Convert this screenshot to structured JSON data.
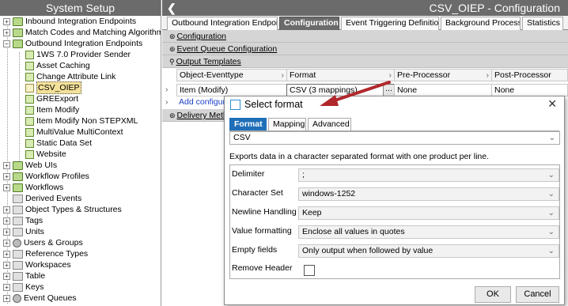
{
  "left_panel": {
    "title": "System Setup",
    "items": [
      {
        "label": "Inbound Integration Endpoints",
        "icon": "folder-icon"
      },
      {
        "label": "Match Codes and Matching Algorithms",
        "icon": "folder-icon"
      },
      {
        "label": "Outbound Integration Endpoints",
        "icon": "folder-icon"
      },
      {
        "label": "1WS 7.0 Provider Sender",
        "icon": "endpoint-icon"
      },
      {
        "label": "Asset Caching",
        "icon": "endpoint-icon"
      },
      {
        "label": "Change Attribute Link",
        "icon": "endpoint-icon"
      },
      {
        "label": "CSV_OIEP",
        "icon": "endpoint-icon"
      },
      {
        "label": "GREExport",
        "icon": "endpoint-icon"
      },
      {
        "label": "Item Modify",
        "icon": "endpoint-icon"
      },
      {
        "label": "Item Modify Non STEPXML",
        "icon": "endpoint-icon"
      },
      {
        "label": "MultiValue MultiContext",
        "icon": "endpoint-icon"
      },
      {
        "label": "Static Data Set",
        "icon": "endpoint-icon"
      },
      {
        "label": "Website",
        "icon": "endpoint-icon"
      },
      {
        "label": "Web UIs",
        "icon": "folder-icon"
      },
      {
        "label": "Workflow Profiles",
        "icon": "folder-icon"
      },
      {
        "label": "Workflows",
        "icon": "folder-icon"
      },
      {
        "label": "Derived Events",
        "icon": "list-icon"
      },
      {
        "label": "Object Types & Structures",
        "icon": "structure-icon"
      },
      {
        "label": "Tags",
        "icon": "tag-icon"
      },
      {
        "label": "Units",
        "icon": "units-icon"
      },
      {
        "label": "Users & Groups",
        "icon": "users-icon"
      },
      {
        "label": "Reference Types",
        "icon": "reference-icon"
      },
      {
        "label": "Workspaces",
        "icon": "workspace-icon"
      },
      {
        "label": "Table",
        "icon": "table-icon"
      },
      {
        "label": "Keys",
        "icon": "key-icon"
      },
      {
        "label": "Event Queues",
        "icon": "queue-icon"
      }
    ]
  },
  "right_panel": {
    "title": "CSV_OIEP - Configuration",
    "tabs": [
      "Outbound Integration Endpoint",
      "Configuration",
      "Event Triggering Definitions",
      "Background Processes",
      "Statistics"
    ],
    "sections": {
      "configuration": "Configuration",
      "event_queue": "Event Queue Configuration",
      "output_templates": "Output Templates",
      "delivery_method": "Delivery Method"
    },
    "grid": {
      "headers": [
        "Object-Eventtype",
        "Format",
        "Pre-Processor",
        "Post-Processor"
      ],
      "row": [
        "Item (Modify)",
        "CSV (3 mappings)",
        "None",
        "None"
      ],
      "add_link": "Add configuration"
    }
  },
  "dialog": {
    "title": "Select format",
    "tabs": [
      "Format",
      "Mapping",
      "Advanced"
    ],
    "format_value": "CSV",
    "description": "Exports data in a character separated format with one product per line.",
    "properties": [
      {
        "label": "Delimiter",
        "value": ";"
      },
      {
        "label": "Character Set",
        "value": "windows-1252"
      },
      {
        "label": "Newline Handling",
        "value": "Keep"
      },
      {
        "label": "Value formatting",
        "value": "Enclose all values in quotes"
      },
      {
        "label": "Empty fields",
        "value": "Only output when followed by value"
      },
      {
        "label": "Remove Header",
        "value": ""
      }
    ],
    "ok_label": "OK",
    "cancel_label": "Cancel"
  },
  "colors": {
    "header_bg": "#6b6b6b",
    "active_tab": "#1f6fb8",
    "arrow": "#b0282c",
    "selection": "#f3e199"
  }
}
